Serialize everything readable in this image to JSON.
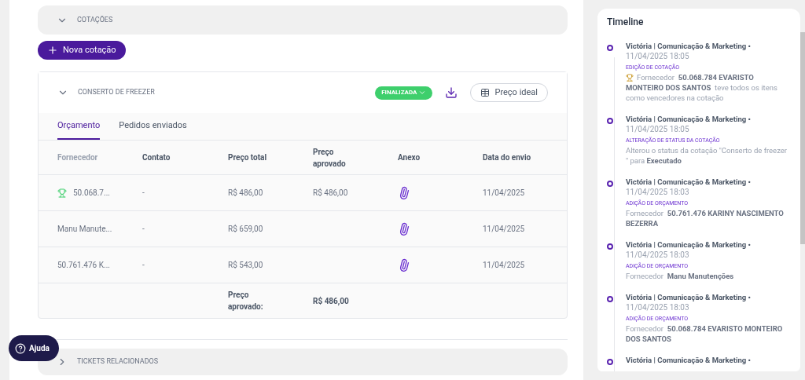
{
  "quotes_section": {
    "title": "COTAÇÕES",
    "expanded": true
  },
  "new_quote_button": "Nova cotação",
  "quote": {
    "title": "CONSERTO DE FREEZER",
    "expanded": true,
    "status": "FINALIZADA",
    "ideal_price_button": "Preço ideal",
    "tabs": [
      {
        "label": "Orçamento",
        "selected": true
      },
      {
        "label": "Pedidos enviados",
        "selected": false
      }
    ],
    "columns": [
      "Fornecedor",
      "Contato",
      "Preço total",
      "Preço aprovado",
      "Anexo",
      "Data do envio"
    ],
    "rows": [
      {
        "supplier": "50.068.7...",
        "winner": true,
        "contact": "-",
        "total": "R$ 486,00",
        "approved": "R$ 486,00",
        "attachment": true,
        "date": "11/04/2025"
      },
      {
        "supplier": "Manu Manute...",
        "winner": false,
        "contact": "-",
        "total": "R$ 659,00",
        "approved": "",
        "attachment": true,
        "date": "11/04/2025"
      },
      {
        "supplier": "50.761.476 K...",
        "winner": false,
        "contact": "-",
        "total": "R$ 543,00",
        "approved": "",
        "attachment": true,
        "date": "11/04/2025"
      }
    ],
    "footer_label": "Preço aprovado:",
    "footer_value": "R$ 486,00"
  },
  "related_section": {
    "title": "TICKETS RELACIONADOS",
    "expanded": false
  },
  "help_button": "Ajuda",
  "timeline": {
    "title": "Timeline",
    "entries": [
      {
        "author": "Victória | Comunicação & Marketing •",
        "datetime": "11/04/2025 18:05",
        "kind": "EDIÇÃO DE COTAÇÃO",
        "trophy": true,
        "message": "Fornecedor  **50.068.784 EVARISTO MONTEIRO DOS SANTOS**  teve todos os itens como vencedores na cotação"
      },
      {
        "author": "Victória | Comunicação & Marketing •",
        "datetime": "11/04/2025 18:05",
        "kind": "ALTERAÇÃO DE STATUS DA COTAÇÃO",
        "trophy": false,
        "message": "Alterou o status da cotação \"Conserto de freezer \" para **Executado**"
      },
      {
        "author": "Victória | Comunicação & Marketing •",
        "datetime": "11/04/2025 18:03",
        "kind": "ADIÇÃO DE ORÇAMENTO",
        "trophy": false,
        "message": "Fornecedor  **50.761.476 KARINY NASCIMENTO BEZERRA**"
      },
      {
        "author": "Victória | Comunicação & Marketing •",
        "datetime": "11/04/2025 18:03",
        "kind": "ADIÇÃO DE ORÇAMENTO",
        "trophy": false,
        "message": "Fornecedor  **Manu Manutenções**"
      },
      {
        "author": "Victória | Comunicação & Marketing •",
        "datetime": "11/04/2025 18:03",
        "kind": "ADIÇÃO DE ORÇAMENTO",
        "trophy": false,
        "message": "Fornecedor  **50.068.784 EVARISTO MONTEIRO DOS SANTOS**"
      },
      {
        "author": "Victória | Comunicação & Marketing •"
      }
    ]
  }
}
